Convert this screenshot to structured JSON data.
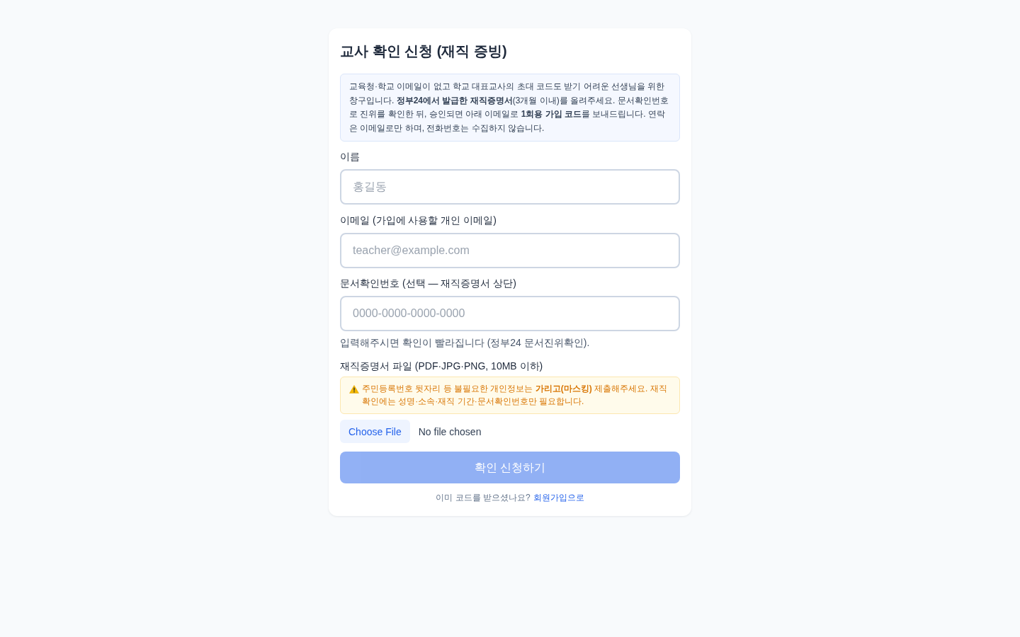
{
  "form": {
    "title": "교사 확인 신청 (재직 증빙)",
    "notice": "교육청·학교 이메일이 없고 학교 대표교사의 초대 코드도 받기 어려운 선생님을 위한 창구입니다. **정부24에서 발급한 재직증명서**(3개월 이내)를 올려주세요. 문서확인번호로 진위를 확인한 뒤, 승인되면 아래 이메일로 **1회용 가입 코드**를 보내드립니다. 연락은 이메일로만 하며, 전화번호는 수집하지 않습니다.",
    "fields": [
      {
        "kind": "text",
        "label": "이름",
        "placeholder": "홍길동"
      },
      {
        "kind": "text",
        "label": "이메일 (가입에 사용할 개인 이메일)",
        "placeholder": "teacher@example.com"
      },
      {
        "kind": "text",
        "label": "문서확인번호 (선택 — 재직증명서 상단)",
        "placeholder": "0000-0000-0000-0000",
        "hint": "입력해주시면 확인이 빨라집니다 (정부24 문서진위확인)."
      },
      {
        "kind": "file",
        "label": "재직증명서 파일 (PDF·JPG·PNG, 10MB 이하)",
        "warning": "주민등록번호 뒷자리 등 불필요한 개인정보는 **가리고(마스킹)** 제출해주세요. 재직 확인에는 성명·소속·재직 기간·문서확인번호만 필요합니다.",
        "button": "Choose File",
        "status": "No file chosen"
      }
    ],
    "submit": {
      "label": "확인 신청하기",
      "disabled": true
    },
    "footer": {
      "text": "이미 코드를 받으셨나요?",
      "link": "회원가입으로"
    }
  }
}
